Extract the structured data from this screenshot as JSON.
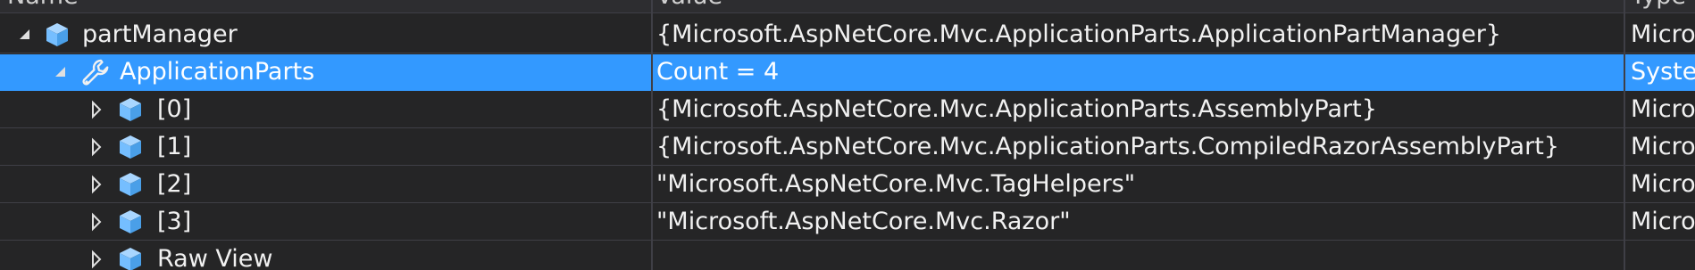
{
  "columns": {
    "name": "Name",
    "value": "Value",
    "type": "Type"
  },
  "rows": [
    {
      "name": "partManager",
      "value": "{Microsoft.AspNetCore.Mvc.ApplicationParts.ApplicationPartManager}",
      "type": "Micro",
      "icon": "object-cube-icon",
      "expander": "expanded"
    },
    {
      "name": "ApplicationParts",
      "value": "Count = 4",
      "type": "Syster",
      "icon": "wrench-property-icon",
      "expander": "expanded",
      "selected": true
    },
    {
      "name": "[0]",
      "value": "{Microsoft.AspNetCore.Mvc.ApplicationParts.AssemblyPart}",
      "type": "Micro",
      "icon": "object-cube-icon",
      "expander": "collapsed"
    },
    {
      "name": "[1]",
      "value": "{Microsoft.AspNetCore.Mvc.ApplicationParts.CompiledRazorAssemblyPart}",
      "type": "Micro",
      "icon": "object-cube-icon",
      "expander": "collapsed"
    },
    {
      "name": "[2]",
      "value": "\"Microsoft.AspNetCore.Mvc.TagHelpers\"",
      "type": "Micro",
      "icon": "object-cube-icon",
      "expander": "collapsed"
    },
    {
      "name": "[3]",
      "value": "\"Microsoft.AspNetCore.Mvc.Razor\"",
      "type": "Micro",
      "icon": "object-cube-icon",
      "expander": "collapsed"
    },
    {
      "name": "Raw View",
      "value": "",
      "type": "",
      "icon": "object-cube-icon",
      "expander": "collapsed"
    }
  ],
  "colors": {
    "background": "#252526",
    "selection": "#3399ff",
    "cube_icon": "#75beff",
    "grid": "#3f3f46"
  }
}
